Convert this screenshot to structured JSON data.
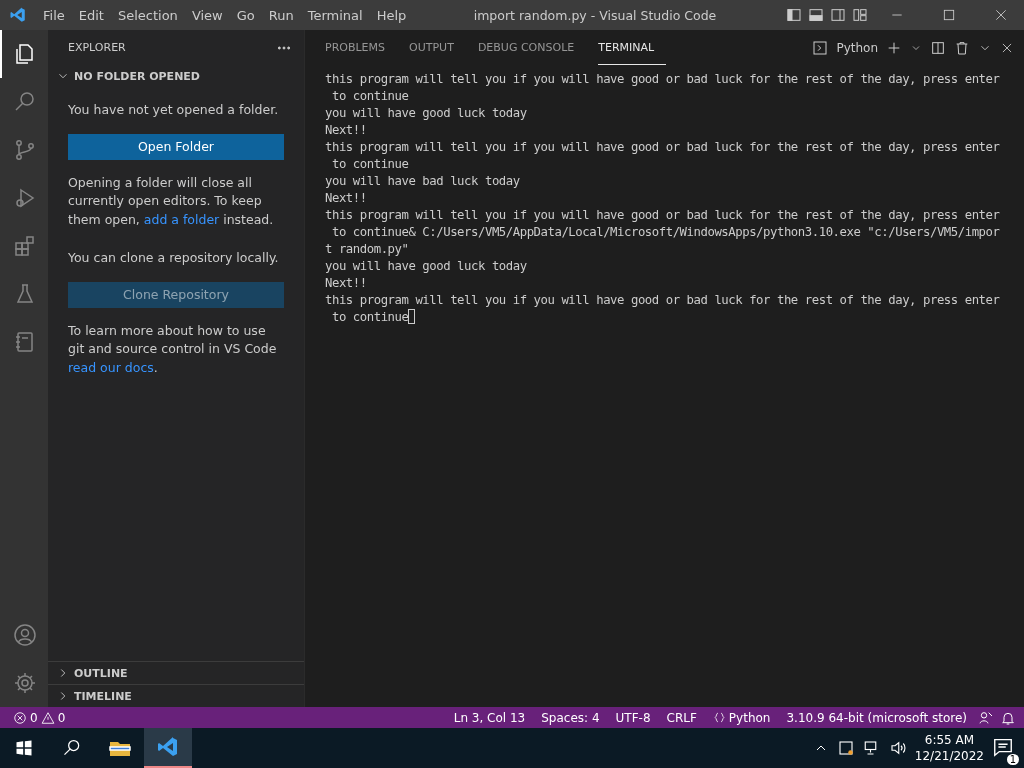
{
  "menu": [
    "File",
    "Edit",
    "Selection",
    "View",
    "Go",
    "Run",
    "Terminal",
    "Help"
  ],
  "window": {
    "title": "import random.py - Visual Studio Code"
  },
  "activity": [
    {
      "kind": "files",
      "selected": true
    },
    {
      "kind": "search",
      "selected": false
    },
    {
      "kind": "source",
      "selected": false
    },
    {
      "kind": "debug",
      "selected": false
    },
    {
      "kind": "extensions",
      "selected": false
    },
    {
      "kind": "testing",
      "selected": false
    },
    {
      "kind": "notebook",
      "selected": false
    }
  ],
  "sidebar": {
    "title": "EXPLORER",
    "section": "NO FOLDER OPENED",
    "intro": "You have not yet opened a folder.",
    "open_button": "Open Folder",
    "note_before": "Opening a folder will close all currently open editors. To keep them open, ",
    "note_link": "add a folder",
    "note_after": " instead.",
    "clone_text": "You can clone a repository locally.",
    "clone_button": {
      "label": "Clone Repository",
      "disabled": true
    },
    "learn_before": "To learn more about how to use git and source control in VS Code ",
    "learn_link": "read our docs",
    "learn_after": ".",
    "collapsed": [
      "OUTLINE",
      "TIMELINE"
    ]
  },
  "panel": {
    "tabs": [
      {
        "label": "PROBLEMS",
        "selected": false
      },
      {
        "label": "OUTPUT",
        "selected": false
      },
      {
        "label": "DEBUG CONSOLE",
        "selected": false
      },
      {
        "label": "TERMINAL",
        "selected": true
      }
    ],
    "shell": "Python",
    "lines": [
      "this program will tell you if you will have good or bad luck for the rest of the day, press enter",
      " to continue",
      "you will have good luck today",
      "Next!!",
      "this program will tell you if you will have good or bad luck for the rest of the day, press enter",
      " to continue",
      "you will have bad luck today",
      "Next!!",
      "this program will tell you if you will have good or bad luck for the rest of the day, press enter",
      " to continue& C:/Users/VM5/AppData/Local/Microsoft/WindowsApps/python3.10.exe \"c:/Users/VM5/impor",
      "t random.py\"",
      "you will have good luck today",
      "Next!!",
      "this program will tell you if you will have good or bad luck for the rest of the day, press enter",
      " to continue"
    ]
  },
  "status_bar": {
    "errors": "0",
    "warnings": "0",
    "items": [
      "Ln 3, Col 13",
      "Spaces: 4",
      "UTF-8",
      "CRLF",
      "Python",
      "3.10.9 64-bit (microsoft store)"
    ]
  },
  "taskbar": {
    "time": "6:55 AM",
    "date": "12/21/2022",
    "notifications": "1"
  }
}
